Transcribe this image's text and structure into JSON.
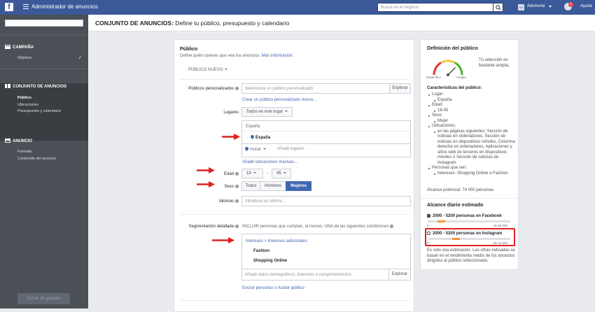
{
  "topbar": {
    "logo": "f",
    "app_title": "Administrador de anuncios",
    "search_placeholder": "Busca en el negocio",
    "account_initials": "NG",
    "account_name": "Adsmurai",
    "notifications": "1",
    "help": "Ayuda"
  },
  "sidebar": {
    "campaign": {
      "title": "CAMPAÑA",
      "items": [
        "Objetivo"
      ]
    },
    "adset": {
      "title": "CONJUNTO DE ANUNCIOS",
      "items": [
        "Público",
        "Ubicaciones",
        "Presupuesto y calendario"
      ]
    },
    "ad": {
      "title": "ANUNCIO",
      "items": [
        "Formato",
        "Contenido del anuncio"
      ]
    },
    "close_button": "Cerrar sin guardar"
  },
  "header": {
    "title_bold": "CONJUNTO DE ANUNCIOS:",
    "title_rest": " Define tu público, presupuesto y calendario"
  },
  "audience": {
    "title": "Público",
    "subtitle": "Define quién quieres que vea tus anuncios.",
    "more_info": "Más información.",
    "new_audience": "PÚBLICO NUEVO",
    "custom_label": "Públicos personalizados",
    "custom_placeholder": "Selecciona un público personalizado",
    "explore": "Explorar",
    "create_link": "Crear un público personalizado nuevo...",
    "locations_label": "Lugares",
    "locations_select": "Todos en este lugar",
    "country_header": "España",
    "country_value": "España",
    "include": "Incluir",
    "add_places_placeholder": "Añade lugares",
    "bulk_link": "Añadir ubicaciones masivas...",
    "age_label": "Edad",
    "age_min": "18",
    "age_sep": "-",
    "age_max": "45",
    "gender_label": "Sexo",
    "genders": [
      "Todos",
      "Hombres",
      "Mujeres"
    ],
    "languages_label": "Idiomas",
    "languages_placeholder": "Introduce un idioma...",
    "targeting_label": "Segmentación detallada",
    "targeting_desc": "INCLUIR personas que cumplan, al menos, UNA de las siguientes condiciones",
    "breadcrumb_a": "Intereses",
    "breadcrumb_sep": " > ",
    "breadcrumb_b": "Intereses adicionales",
    "interests": [
      "Fashion",
      "Shopping Online"
    ],
    "targeting_placeholder": "Añade datos demográficos, intereses o comportamientos",
    "exclude_a": "Excluir personas",
    "exclude_sep": " o ",
    "exclude_b": "Acotar público"
  },
  "definition": {
    "title": "Definición del público",
    "gauge_left": "Específico",
    "gauge_right": "Amplio",
    "gauge_text": "Tu selección es bastante amplia.",
    "gauge_level": 0.75,
    "chars_title": "Características del público:",
    "items": [
      {
        "label": "Lugar:",
        "values": [
          "España"
        ]
      },
      {
        "label": "Edad:",
        "values": [
          "18-45"
        ]
      },
      {
        "label": "Sexo:",
        "values": [
          "Mujer"
        ]
      },
      {
        "label": "Ubicaciones:",
        "values": [
          "en las páginas siguientes: Sección de noticias en ordenadores, Sección de noticias en dispositivos móviles, Columna derecha en ordenadores, Aplicaciones y sitios web de terceros en dispositivos móviles o Sección de noticias de Instagram"
        ]
      },
      {
        "label": "Personas que ven:",
        "values": [
          "Intereses: Shopping Online o Fashion"
        ]
      }
    ],
    "potential_reach": "Alcance potencial: 74 000 personas"
  },
  "daily_reach": {
    "title": "Alcance diario estimado",
    "facebook": {
      "text": "2000 - 5200 personas en Facebook",
      "min": "0",
      "max": "de 66 000"
    },
    "instagram": {
      "text": "2000 - 5200 personas en Instagram",
      "min": "0",
      "max": "de 24 000"
    },
    "note": "Es solo una estimación. Las cifras indicadas se basan en el rendimiento medio de los anuncios dirigidos al público seleccionado."
  },
  "colors": {
    "facebook_blue": "#3b5998",
    "accent": "#4267b2",
    "highlight": "#e02020",
    "reach_orange": "#f7923b"
  }
}
